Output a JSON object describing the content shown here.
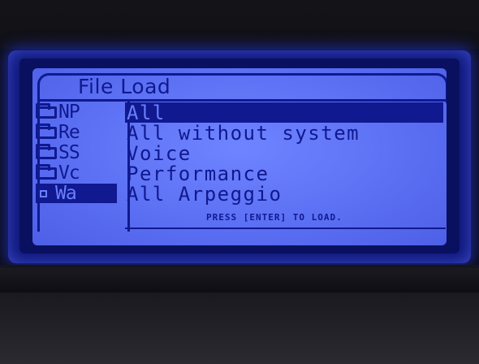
{
  "screen": {
    "title": "File Load",
    "files": [
      {
        "label": "NP",
        "icon": "folder-icon",
        "active": false
      },
      {
        "label": "Re",
        "icon": "folder-icon",
        "active": false
      },
      {
        "label": "SS",
        "icon": "folder-icon",
        "active": false
      },
      {
        "label": "Vc",
        "icon": "folder-icon",
        "active": false
      },
      {
        "label": "Wa",
        "icon": "file-icon",
        "active": true
      }
    ],
    "options": [
      {
        "label": "All",
        "selected": true
      },
      {
        "label": "All without system",
        "selected": false
      },
      {
        "label": "Voice",
        "selected": false
      },
      {
        "label": "Performance",
        "selected": false
      },
      {
        "label": "All Arpeggio",
        "selected": false
      }
    ],
    "footer": "PRESS [ENTER] TO LOAD."
  },
  "colors": {
    "lcd_background": "#6a7ffd",
    "lcd_ink": "#10198f",
    "backlight_glow": "#2f3cff"
  }
}
